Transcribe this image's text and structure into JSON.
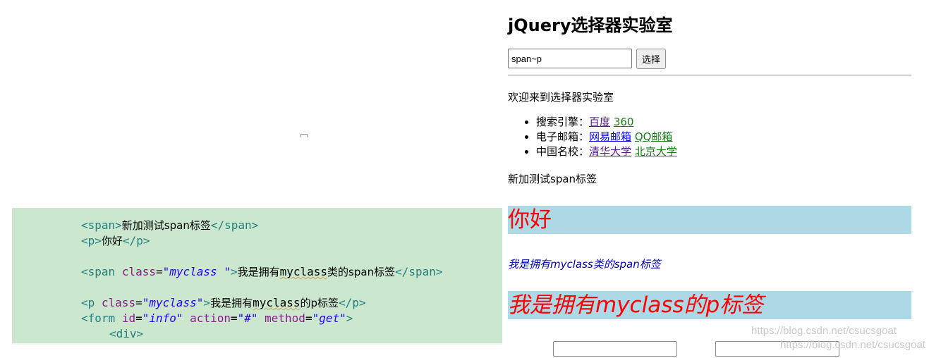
{
  "code": {
    "l1": {
      "open": "<span>",
      "text": "新加测试span标签",
      "close": "</span>"
    },
    "l2": {
      "open": "<p>",
      "text": "你好",
      "close": "</p>"
    },
    "l3": {
      "open": "<span",
      "attr": "class",
      "eq": "=",
      "val": "\"myclass \"",
      "gt": ">",
      "text_a": "我是拥有",
      "text_b": "myclass",
      "text_c": "类的span标签",
      "close": "</span>"
    },
    "l4": {
      "open": "<p",
      "attr": "class",
      "eq": "=",
      "val": "\"myclass\"",
      "gt": ">",
      "text_a": "我是拥有",
      "text_b": "myclass",
      "text_c": "的p标签",
      "close": "</p>"
    },
    "l5": {
      "open": "<form",
      "attr1": "id",
      "eq1": "=",
      "val1": "\"info\"",
      "attr2": "action",
      "eq2": "=",
      "val2": "\"#\"",
      "attr3": "method",
      "eq3": "=",
      "val3": "\"get\"",
      "gt": ">"
    },
    "l6": {
      "open": "<div>"
    }
  },
  "page": {
    "title": "jQuery选择器实验室",
    "selector_input": {
      "value": "span~p"
    },
    "select_button": "选择",
    "welcome": "欢迎来到选择器实验室",
    "links": [
      {
        "label": "搜索引擎：",
        "a1": "百度",
        "a2": "360"
      },
      {
        "label": "电子邮箱：",
        "a1": "网易邮箱",
        "a2": "QQ邮箱"
      },
      {
        "label": "中国名校：",
        "a1": "清华大学",
        "a2": "北京大学"
      }
    ],
    "span_test": "新加测试span标签",
    "p_hello": "你好",
    "span_myclass": "我是拥有myclass类的span标签",
    "p_myclass": "我是拥有myclass的p标签",
    "colors": {
      "highlight_bg": "#add8e6",
      "highlight_text": "#ff0000",
      "code_bg": "#cbe8cf"
    }
  },
  "watermark": {
    "line1": "https://blog.csdn.net/csucsgoat",
    "line2": "https://blog.csdn.net/csucsgoat"
  }
}
